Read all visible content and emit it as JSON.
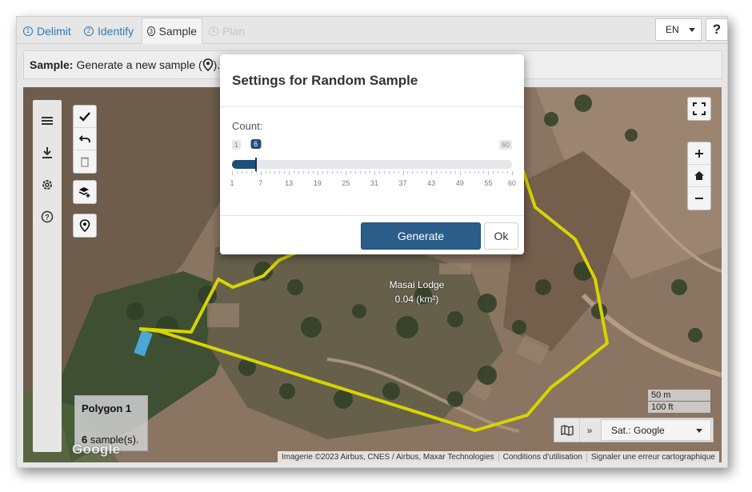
{
  "tabs": [
    {
      "num": "1",
      "label": "Delimit",
      "state": "link"
    },
    {
      "num": "2",
      "label": "Identify",
      "state": "link"
    },
    {
      "num": "3",
      "label": "Sample",
      "state": "active"
    },
    {
      "num": "4",
      "label": "Plan",
      "state": "disabled"
    }
  ],
  "language": "EN",
  "help_label": "?",
  "infobar": {
    "bold": "Sample:",
    "text": "Generate a new sample (",
    "text_end": ")."
  },
  "map": {
    "place_name": "Masai Lodge",
    "place_area": "0.04 (km²)",
    "polygon_title": "Polygon 1",
    "polygon_count": "6",
    "polygon_count_suffix": "sample(s).",
    "google_logo": "Google",
    "scale_m": "50 m",
    "scale_ft": "100 ft",
    "layer_select": "Sat.: Google",
    "attribution": [
      "Imagerie ©2023 Airbus, CNES / Airbus, Maxar Technologies",
      "Conditions d'utilisation",
      "Signaler une erreur cartographique"
    ],
    "polygon_color": "#d8d400"
  },
  "modal": {
    "title": "Settings for Random Sample",
    "count_label": "Count:",
    "slider": {
      "min": 1,
      "max": 60,
      "value": 6,
      "ticks": [
        "1",
        "7",
        "13",
        "19",
        "25",
        "31",
        "37",
        "43",
        "49",
        "55",
        "60"
      ]
    },
    "min_label": "1",
    "max_label": "60",
    "value_label": "6",
    "generate_label": "Generate",
    "ok_label": "Ok"
  },
  "colors": {
    "accent": "#2a5d8a",
    "link": "#2f7ab0"
  },
  "icons": {
    "left_toolbar": [
      "menu-icon",
      "download-icon",
      "gear-icon",
      "help-circle-icon"
    ],
    "draw_tools": [
      "check-icon",
      "undo-icon",
      "trash-icon",
      "layers-add-icon",
      "map-pin-icon"
    ]
  }
}
